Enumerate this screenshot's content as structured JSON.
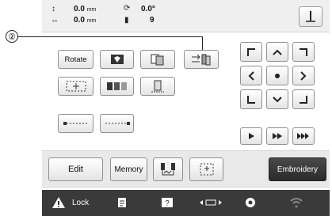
{
  "callout": {
    "number": "②"
  },
  "status": {
    "x_value": "0.0",
    "y_value": "0.0",
    "unit": "mm",
    "angle": "0.0°",
    "thread_count": "9"
  },
  "edit_panel": {
    "rotate_label": "Rotate"
  },
  "toolbar": {
    "edit_label": "Edit",
    "memory_label": "Memory",
    "embroidery_label": "Embroidery"
  },
  "footer": {
    "lock_label": "Lock"
  }
}
